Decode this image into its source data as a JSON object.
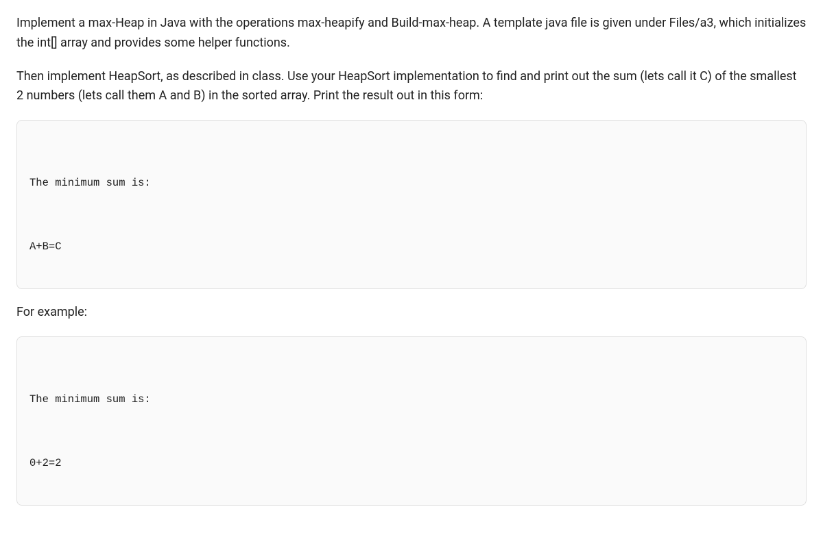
{
  "paragraphs": {
    "p1": "Implement a max-Heap in Java with the operations max-heapify and Build-max-heap. A template java file is given under Files/a3, which initializes the int[] array and provides some helper functions.",
    "p2": "Then implement HeapSort, as described in class. Use your HeapSort implementation to find and print out the sum (lets call it C) of the smallest 2 numbers (lets call them A and B) in the sorted array. Print the result out in this form:",
    "p3": "For example:"
  },
  "codeblocks": {
    "block1": {
      "line1": "The minimum sum is:",
      "line2": "A+B=C"
    },
    "block2": {
      "line1": "The minimum sum is:",
      "line2": "0+2=2"
    }
  }
}
